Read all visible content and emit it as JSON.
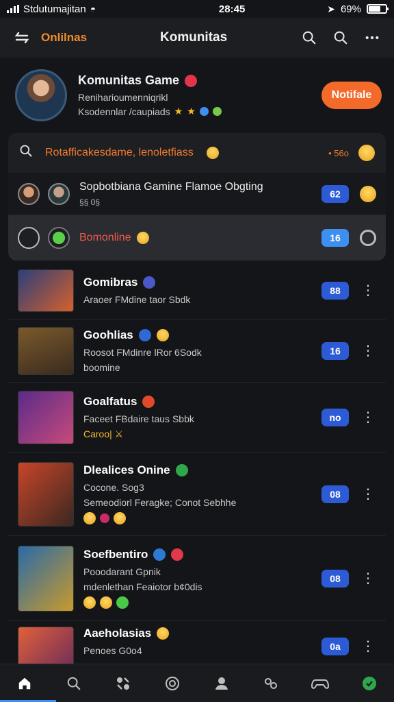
{
  "status": {
    "carrier": "Stdutumajitan",
    "time": "28:45",
    "battery": "69%"
  },
  "header": {
    "left_label": "Onlilnas",
    "title": "Komunitas"
  },
  "profile": {
    "name": "Komunitas Game",
    "subtitle": "Reniharioumenniqrikl",
    "subtitle2": "Ksodennlar /caupiads",
    "action_label": "Notifale"
  },
  "search": {
    "text": "Rotafficakesdame, lenoletfiass",
    "count": "• 56o"
  },
  "rows": [
    {
      "title": "Sopbotbiana Gamine Flamoe Obgting",
      "sub": "§§ 0§",
      "count": "62"
    },
    {
      "title": "Bomonline",
      "count": "16"
    }
  ],
  "games": [
    {
      "title": "Gomibras",
      "sub": "Araoer FMdine taor Sbdk",
      "count": "88",
      "badge_color": "#4b58c9",
      "thumb_colors": [
        "#2b3f7a",
        "#d6602b"
      ]
    },
    {
      "title": "Goohlias",
      "sub": "Roosot FMdinre lRor 6Sodk",
      "sub2": "boomine",
      "count": "16",
      "badge_color": "#2d6ad6",
      "thumb_colors": [
        "#7a5a2b",
        "#3a2a1f"
      ]
    },
    {
      "title": "Goalfatus",
      "sub": "Faceet FBdaire taus Sbbk",
      "sub2": "Caroo| ⚔",
      "count": "no",
      "badge_color": "#e04a2a",
      "thumb_colors": [
        "#5a2b8a",
        "#c84a7a"
      ]
    },
    {
      "title": "Dlealices Onine",
      "sub": "Cocone. Sog3",
      "sub2": "Semeodiorl Feragke; Conot Sebhhe",
      "count": "08",
      "badge_color": "#2ea84a",
      "thumb_colors": [
        "#c8452a",
        "#3a2820"
      ]
    },
    {
      "title": "Soefbentiro",
      "sub": "Pooodarant Gpnik",
      "sub2": "mdenlethan Feaiotor b¢0dis",
      "count": "08",
      "badge_color": "#2d7ad6",
      "thumb_colors": [
        "#2a6aa8",
        "#c89a2b"
      ]
    },
    {
      "title": "Aaeholasias",
      "sub": "Penoes G0o4",
      "count": "0a",
      "badge_color": "#f5b82b",
      "thumb_colors": [
        "#e0603a",
        "#6a2a5a"
      ]
    }
  ],
  "nav": [
    "home-icon",
    "search-icon",
    "games-icon",
    "chat-icon",
    "profile-icon",
    "friends-icon",
    "controller-icon",
    "online-icon"
  ]
}
